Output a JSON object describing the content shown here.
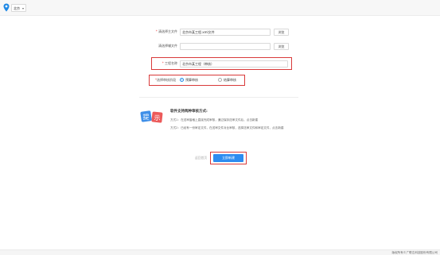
{
  "topbar": {
    "location_icon": "map-pin-icon",
    "city": "北京",
    "accent": "#1e88e5"
  },
  "form": {
    "main_file": {
      "required_mark": "*",
      "label": "清选择主文件",
      "value": "北京市某工程.xml文件",
      "button": "浏览"
    },
    "aux_file": {
      "label": "清选择辅文件",
      "value": "",
      "button": "浏览"
    },
    "project_name": {
      "required_mark": "*",
      "label": "工程名称",
      "value": "北京市某工程（审核）"
    },
    "review_stage": {
      "required_mark": "*",
      "label": "选择审核阶段",
      "options": [
        {
          "label": "预算审核",
          "selected": true
        },
        {
          "label": "结算审核",
          "selected": false
        }
      ]
    }
  },
  "tips": {
    "icon_text": "提示",
    "title": "软件支持两种审核方式:",
    "line1": "方式1：在送审窗格上直接完成审核，通过保存送审文件后，点击新建",
    "line2": "方式2：已经有一份审定文件，在送审文件对比审核，选择送审文件和审定文件，点击新建"
  },
  "actions": {
    "back": "返回首页",
    "create": "立即新建"
  },
  "footer": {
    "copyright": "版权所有©广联达科技股份有限公司"
  },
  "colors": {
    "highlight": "#d93a3a",
    "primary_button": "#2d8cf0"
  }
}
